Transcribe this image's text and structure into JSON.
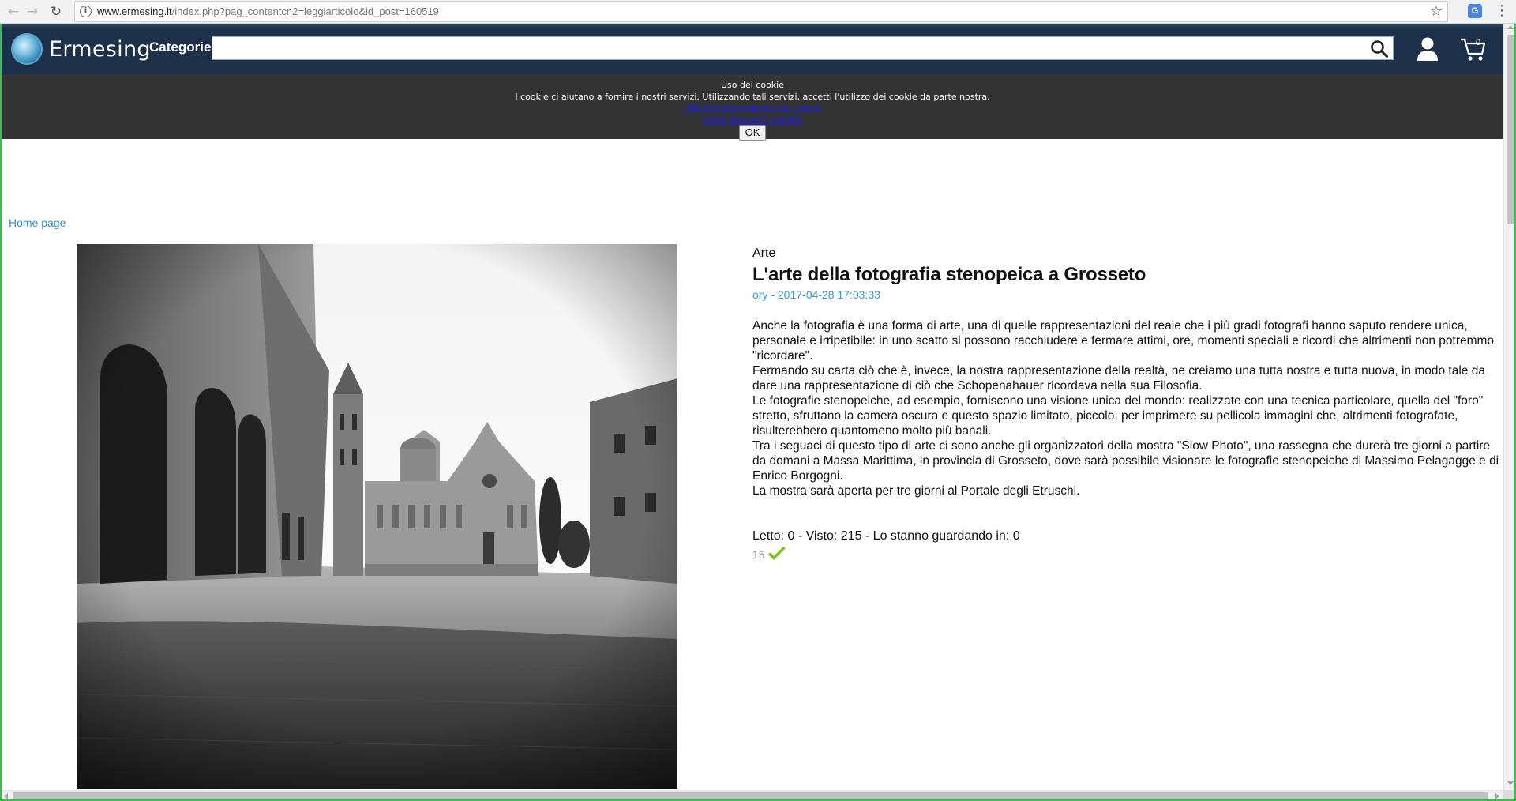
{
  "browser": {
    "url_host": "www.ermesing.it",
    "url_path": "/index.php?pag_contentcn2=leggiarticolo&id_post=160519",
    "back_icon": "arrow-left-icon",
    "forward_icon": "arrow-right-icon",
    "reload_icon": "reload-icon",
    "bookmark_icon": "star-icon",
    "extension_label": "G",
    "menu_icon": "vertical-dots-icon"
  },
  "header": {
    "logo_text": "Ermesing",
    "categories_label": "Categorie",
    "search_value": "",
    "search_placeholder": "",
    "cart_count": "0",
    "background_color": "#1d3049"
  },
  "cookie_banner": {
    "title": "Uso dei cookie",
    "text": "I cookie ci aiutano a fornire i nostri servizi. Utilizzando tali servizi, accetti l'utilizzo dei cookie da parte nostra.",
    "link_more": "Ulteriori informazioni sui cookie",
    "link_manage": "Come bloccare i cookie",
    "ok_label": "OK",
    "background_color": "#333333"
  },
  "breadcrumb": {
    "home": "Home page"
  },
  "article": {
    "category": "Arte",
    "title": "L'arte della fotografia stenopeica a Grosseto",
    "meta": "ory - 2017-04-28 17:03:33",
    "paragraphs": [
      "Anche la fotografia è una forma di arte, una di quelle rappresentazioni del reale che i più gradi fotografi hanno saputo rendere unica, personale e irripetibile: in uno scatto si possono racchiudere e fermare attimi, ore, momenti speciali e ricordi che altrimenti non potremmo \"ricordare\".",
      "Fermando su carta ciò che è, invece, la nostra rappresentazione della realtà, ne creiamo una tutta nostra e tutta nuova, in modo tale da dare una rappresentazione di ciò che Schopenahauer ricordava nella sua Filosofia.",
      "Le fotografie stenopeiche, ad esempio, forniscono una visione unica del mondo: realizzate con una tecnica particolare, quella del \"foro\" stretto, sfruttano la camera oscura e questo spazio limitato, piccolo, per imprimere su pellicola immagini che, altrimenti fotografate, risulterebbero quantomeno molto più banali.",
      "Tra i seguaci di questo tipo di arte ci sono anche gli organizzatori della mostra \"Slow Photo\", una rassegna che durerà tre giorni a partire da domani a Massa Marittima, in provincia di Grosseto, dove sarà possibile visionare le fotografie stenopeiche di Massimo Pelagagge e di Enrico Borgogni.",
      "La mostra sarà aperta per tre giorni al Portale degli Etruschi."
    ],
    "stats": "Letto: 0 - Visto: 215 - Lo stanno guardando in: 0",
    "likes": "15",
    "like_icon": "checkmark-icon",
    "image_alt": "Black and white pinhole photograph of a piazza with arcades and a cathedral"
  },
  "colors": {
    "link_blue": "#2f8fd0",
    "meta_blue": "#3a9ad9",
    "check_green": "#7dc21e",
    "frame_green": "#2fc548"
  }
}
